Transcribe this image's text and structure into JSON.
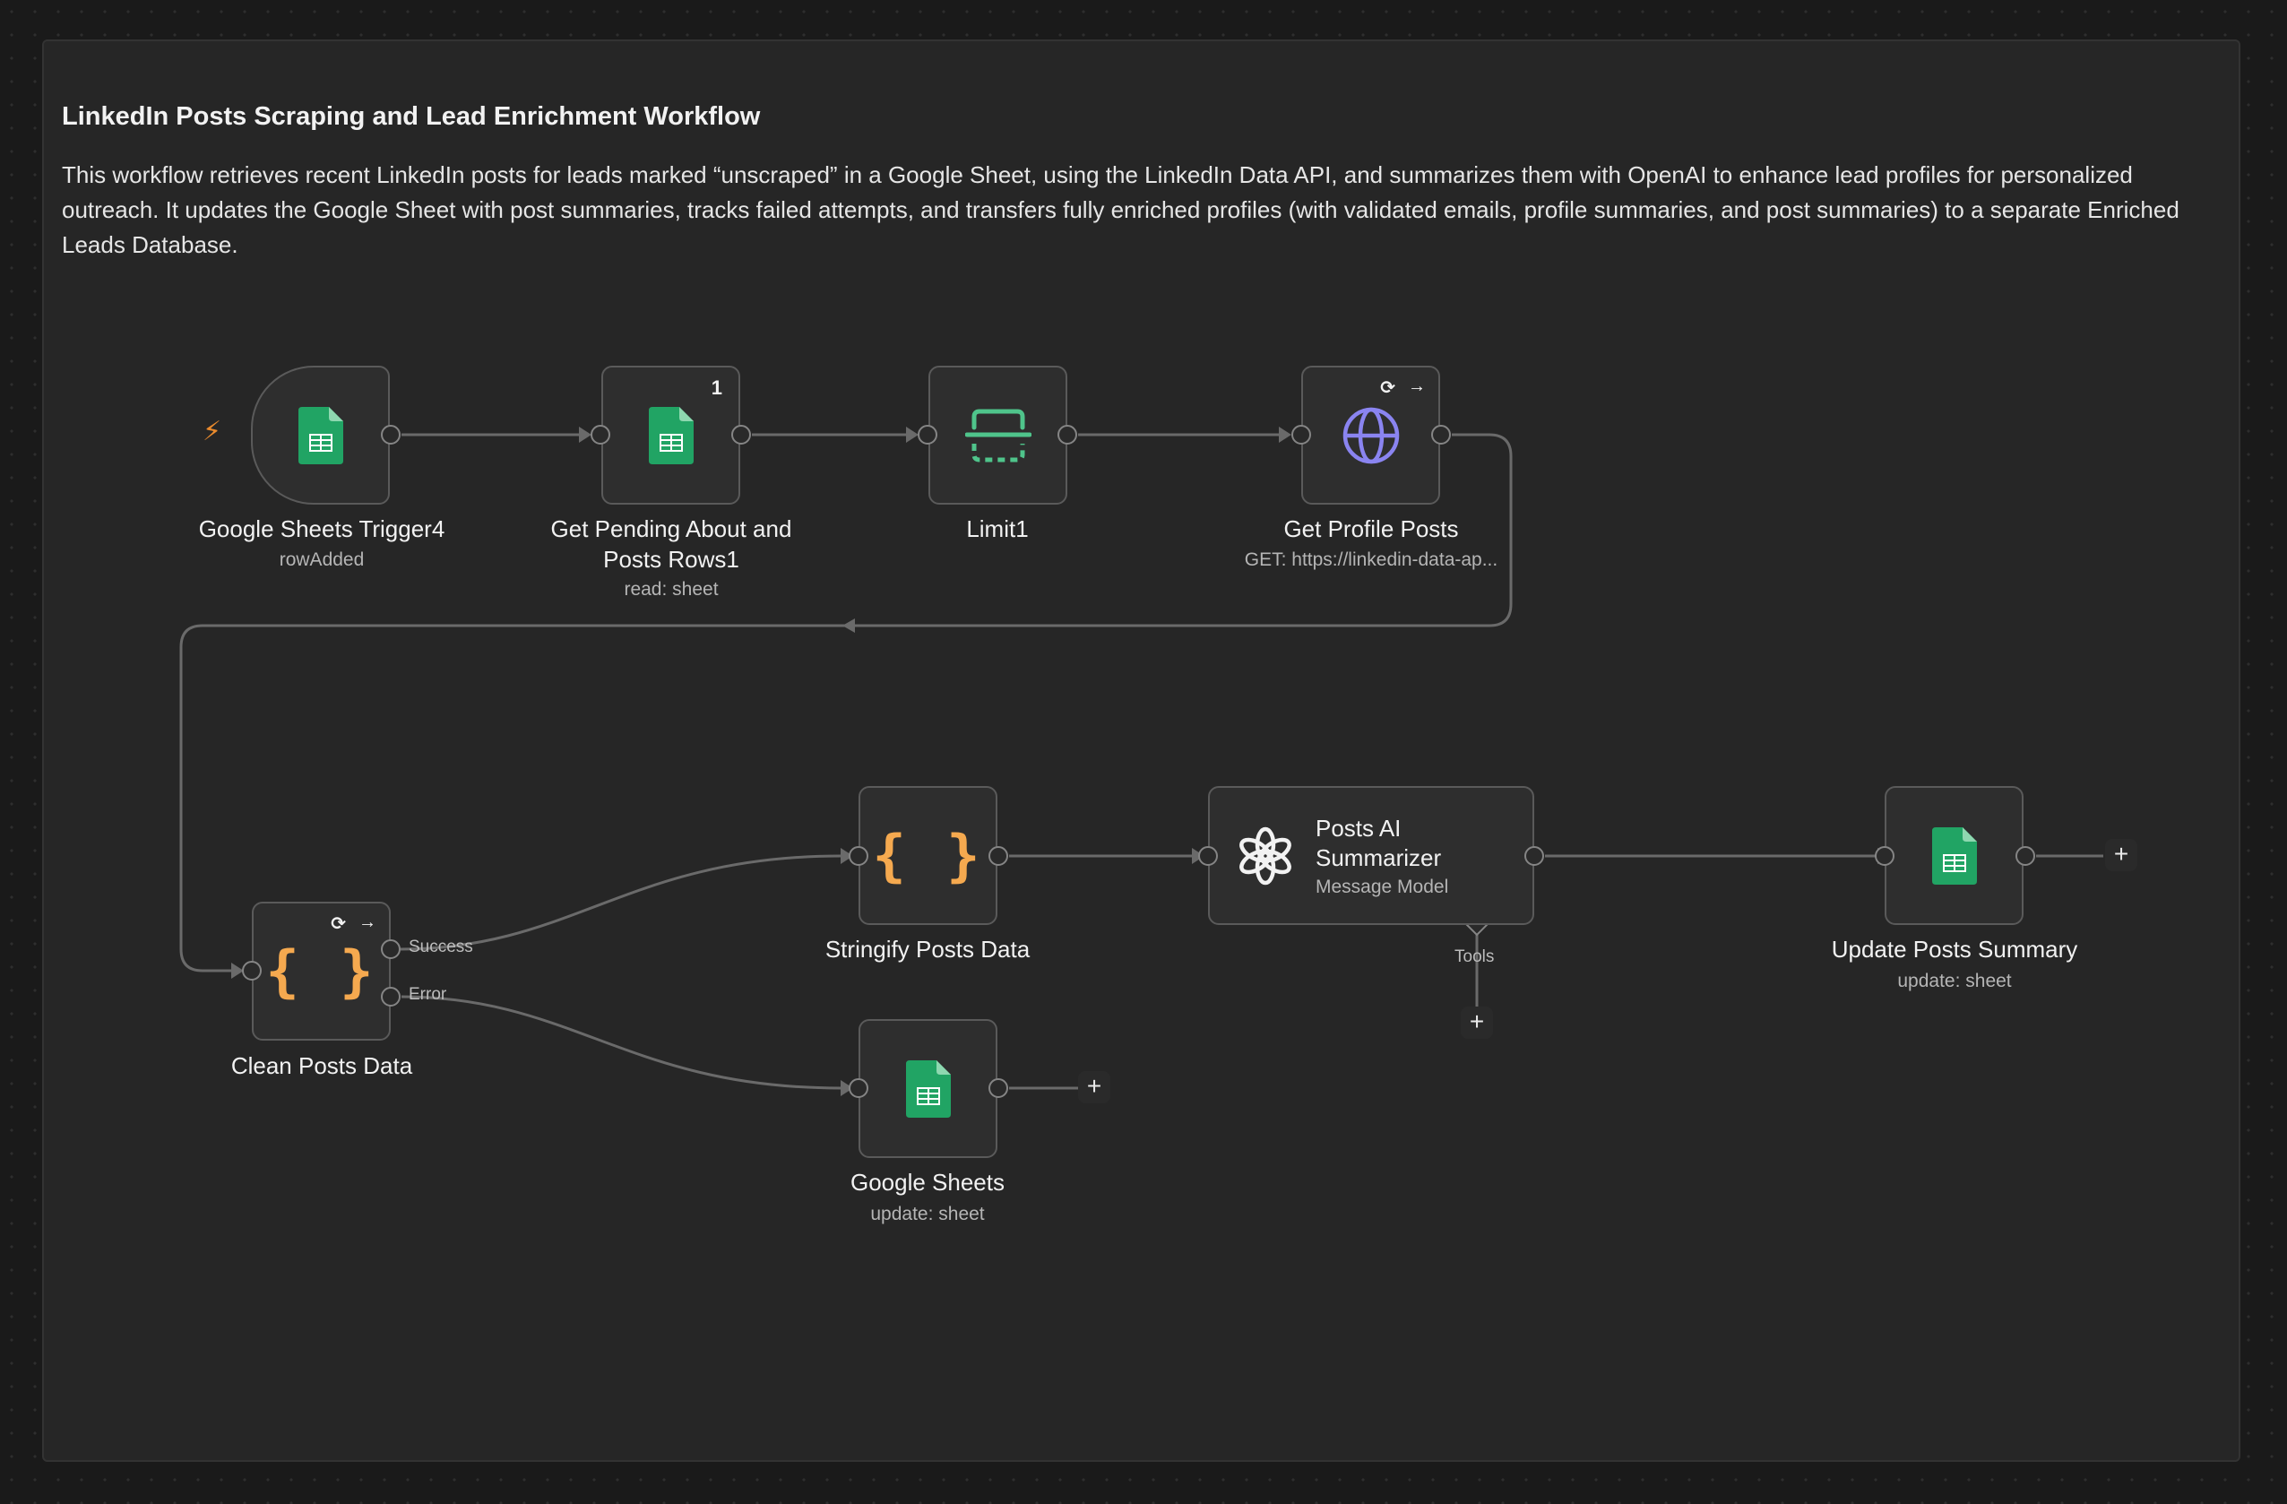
{
  "sticky": {
    "title": "LinkedIn Posts Scraping and Lead Enrichment Workflow",
    "description": "This workflow retrieves recent LinkedIn posts for leads marked “unscraped” in a Google Sheet, using the LinkedIn Data API, and summarizes them with OpenAI to enhance lead profiles for personalized outreach. It updates the Google Sheet with post summaries, tracks failed attempts, and transfers fully enriched profiles (with validated emails, profile summaries, and post summaries) to a separate Enriched Leads Database."
  },
  "nodes": {
    "trigger": {
      "name": "Google Sheets Trigger4",
      "subtitle": "rowAdded",
      "icon": "google-sheets-icon",
      "trigger_icon": "lightning-bolt-icon",
      "bolt": "⚡"
    },
    "get_pending": {
      "name": "Get Pending About and Posts Rows1",
      "subtitle": "read: sheet",
      "icon": "google-sheets-icon",
      "badge": "1"
    },
    "limit": {
      "name": "Limit1",
      "icon": "limit-icon"
    },
    "get_posts": {
      "name": "Get Profile Posts",
      "subtitle": "GET: https://linkedin-data-ap...",
      "icon": "globe-icon",
      "retry": "⟳",
      "continue": "→"
    },
    "clean": {
      "name": "Clean Posts Data",
      "icon": "code-braces-icon",
      "glyph": "{ }",
      "retry": "⟳",
      "continue": "→",
      "output_success": "Success",
      "output_error": "Error"
    },
    "stringify": {
      "name": "Stringify Posts Data",
      "icon": "code-braces-icon",
      "glyph": "{ }"
    },
    "summarizer": {
      "name": "Posts AI Summarizer",
      "subtitle": "Message Model",
      "icon": "openai-icon",
      "tools_label": "Tools"
    },
    "update_summary": {
      "name": "Update Posts Summary",
      "subtitle": "update: sheet",
      "icon": "google-sheets-icon"
    },
    "google_sheets": {
      "name": "Google Sheets",
      "subtitle": "update: sheet",
      "icon": "google-sheets-icon"
    }
  },
  "plus_symbol": "+",
  "colors": {
    "sheets_green": "#21a464",
    "limit_green": "#4fc48b",
    "globe_purple": "#8a84f0",
    "code_orange": "#f5a94f",
    "trigger_orange": "#e98a2d"
  }
}
